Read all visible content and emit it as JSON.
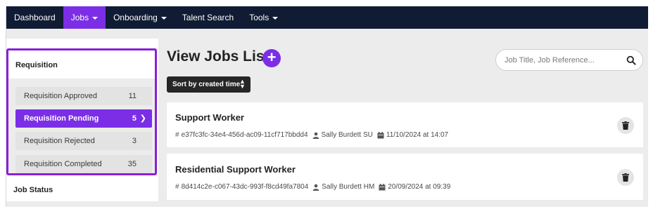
{
  "nav": {
    "items": [
      {
        "label": "Dashboard",
        "dropdown": false,
        "active": false
      },
      {
        "label": "Jobs",
        "dropdown": true,
        "active": true
      },
      {
        "label": "Onboarding",
        "dropdown": true,
        "active": false
      },
      {
        "label": "Talent Search",
        "dropdown": false,
        "active": false
      },
      {
        "label": "Tools",
        "dropdown": true,
        "active": false
      }
    ]
  },
  "sidebar": {
    "requisition_title": "Requisition",
    "items": [
      {
        "label": "Requisition Approved",
        "count": "11"
      },
      {
        "label": "Requisition Pending",
        "count": "5"
      },
      {
        "label": "Requisition Rejected",
        "count": "3"
      },
      {
        "label": "Requisition Completed",
        "count": "35"
      }
    ],
    "job_status_title": "Job Status"
  },
  "main": {
    "title": "View Jobs List",
    "add_icon": "plus-icon",
    "search_placeholder": "Job Title, Job Reference...",
    "sort_label": "Sort by created time",
    "jobs": [
      {
        "title": "Support Worker",
        "reference": "e37fc3fc-34e4-456d-ac09-11cf717bbdd4",
        "owner": "Sally Burdett SU",
        "created": "11/10/2024 at 14:07"
      },
      {
        "title": "Residential Support Worker",
        "reference": "8d414c2e-c067-43dc-993f-f8cd49fa7804",
        "owner": "Sally Burdett HM",
        "created": "20/09/2024 at 09:39"
      }
    ]
  },
  "colors": {
    "nav_bg": "#101b34",
    "accent": "#7b2ee6",
    "highlight_border": "#8a1fd9"
  }
}
